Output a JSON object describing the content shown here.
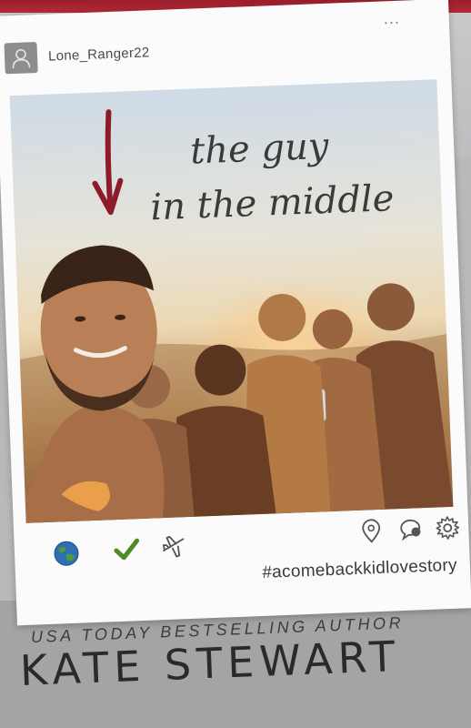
{
  "post": {
    "username": "Lone_Ranger22",
    "more_label": "...",
    "title_line_1": "the guy",
    "title_line_2": "in the middle",
    "hashtag": "#acomebackkidlovestory"
  },
  "icons": {
    "globe": "globe-icon",
    "check": "check-icon",
    "plane": "airplane-icon",
    "pin": "location-pin-icon",
    "comment": "comment-icon",
    "gear": "gear-icon"
  },
  "cover": {
    "tagline": "USA TODAY BESTSELLING AUTHOR",
    "author": "KATE STEWART"
  },
  "colors": {
    "arrow": "#8e1b2a",
    "check": "#4f8a2a",
    "accent_red": "#a12433"
  }
}
